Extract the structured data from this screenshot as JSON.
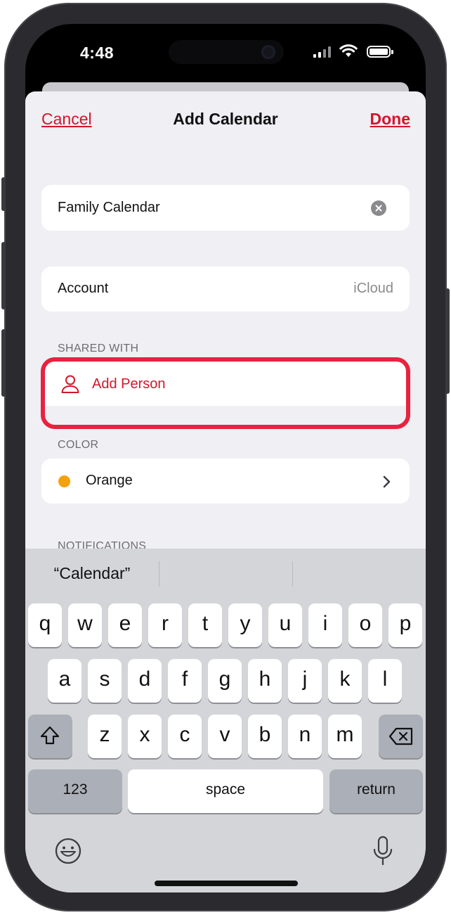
{
  "status_bar": {
    "time": "4:48"
  },
  "nav": {
    "cancel": "Cancel",
    "title": "Add Calendar",
    "done": "Done"
  },
  "name_field": {
    "value": "Family Calendar"
  },
  "account": {
    "label": "Account",
    "value": "iCloud"
  },
  "shared_with": {
    "header": "SHARED WITH",
    "add_person": "Add Person"
  },
  "color": {
    "header": "COLOR",
    "value": "Orange",
    "swatch": "#f5a00f"
  },
  "notifications": {
    "header": "NOTIFICATIONS"
  },
  "keyboard": {
    "suggestion": "“Calendar”",
    "row1": [
      "q",
      "w",
      "e",
      "r",
      "t",
      "y",
      "u",
      "i",
      "o",
      "p"
    ],
    "row2": [
      "a",
      "s",
      "d",
      "f",
      "g",
      "h",
      "j",
      "k",
      "l"
    ],
    "row3": [
      "z",
      "x",
      "c",
      "v",
      "b",
      "n",
      "m"
    ],
    "numbers_key": "123",
    "space_key": "space",
    "return_key": "return"
  },
  "colors": {
    "accent": "#d3162a",
    "highlight": "#e8223f"
  }
}
